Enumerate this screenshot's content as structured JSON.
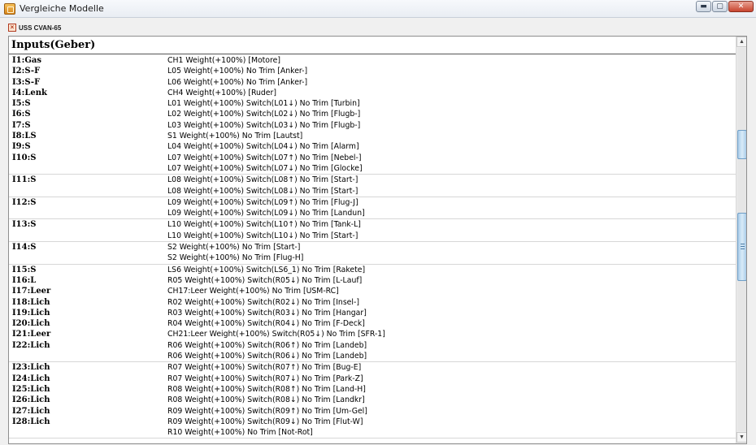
{
  "window": {
    "title": "Vergleiche Modelle",
    "buttons": {
      "minimize": "▬",
      "maximize": "▢",
      "close": "✕"
    }
  },
  "tab": {
    "icon": "document-icon",
    "label": "USS CVAN-65"
  },
  "section": {
    "title": "Inputs(Geber)"
  },
  "inputs": [
    {
      "label": "I1:Gas",
      "lines": [
        "CH1 Weight(+100%) [Motore]"
      ]
    },
    {
      "label": "I2:S-F",
      "lines": [
        "L05 Weight(+100%) No Trim [Anker-]"
      ]
    },
    {
      "label": "I3:S-F",
      "lines": [
        "L06 Weight(+100%) No Trim [Anker-]"
      ]
    },
    {
      "label": "I4:Lenk",
      "lines": [
        "CH4 Weight(+100%) [Ruder]"
      ]
    },
    {
      "label": "I5:S",
      "lines": [
        "L01 Weight(+100%) Switch(L01↓) No Trim [Turbin]"
      ]
    },
    {
      "label": "I6:S",
      "lines": [
        "L02 Weight(+100%) Switch(L02↓) No Trim [Flugb-]"
      ]
    },
    {
      "label": "I7:S",
      "lines": [
        "L03 Weight(+100%) Switch(L03↓) No Trim [Flugb-]"
      ]
    },
    {
      "label": "I8:LS",
      "lines": [
        "S1 Weight(+100%) No Trim [Lautst]"
      ]
    },
    {
      "label": "I9:S",
      "lines": [
        "L04 Weight(+100%) Switch(L04↓) No Trim [Alarm]"
      ]
    },
    {
      "label": "I10:S",
      "lines": [
        "L07 Weight(+100%) Switch(L07↑) No Trim [Nebel-]",
        "L07 Weight(+100%) Switch(L07↓) No Trim [Glocke]"
      ]
    },
    {
      "label": "I11:S",
      "lines": [
        "L08 Weight(+100%) Switch(L08↑) No Trim [Start-]",
        "L08 Weight(+100%) Switch(L08↓) No Trim [Start-]"
      ]
    },
    {
      "label": "I12:S",
      "lines": [
        "L09 Weight(+100%) Switch(L09↑) No Trim [Flug-J]",
        "L09 Weight(+100%) Switch(L09↓) No Trim [Landun]"
      ]
    },
    {
      "label": "I13:S",
      "lines": [
        "L10 Weight(+100%) Switch(L10↑) No Trim [Tank-L]",
        "L10 Weight(+100%) Switch(L10↓) No Trim [Start-]"
      ]
    },
    {
      "label": "I14:S",
      "lines": [
        "S2 Weight(+100%) No Trim [Start-]",
        "S2 Weight(+100%) No Trim [Flug-H]"
      ]
    },
    {
      "label": "I15:S",
      "lines": [
        "LS6 Weight(+100%) Switch(LS6_1) No Trim [Rakete]"
      ]
    },
    {
      "label": "I16:L",
      "lines": [
        "R05 Weight(+100%) Switch(R05↓) No Trim [L-Lauf]"
      ]
    },
    {
      "label": "I17:Leer",
      "lines": [
        "CH17:Leer Weight(+100%) No Trim [USM-RC]"
      ]
    },
    {
      "label": "I18:Lich",
      "lines": [
        "R02 Weight(+100%) Switch(R02↓) No Trim [Insel-]"
      ]
    },
    {
      "label": "I19:Lich",
      "lines": [
        "R03 Weight(+100%) Switch(R03↓) No Trim [Hangar]"
      ]
    },
    {
      "label": "I20:Lich",
      "lines": [
        "R04 Weight(+100%) Switch(R04↓) No Trim [F-Deck]"
      ]
    },
    {
      "label": "I21:Leer",
      "lines": [
        "CH21:Leer Weight(+100%) Switch(R05↓) No Trim [SFR-1]"
      ]
    },
    {
      "label": "I22:Lich",
      "lines": [
        "R06 Weight(+100%) Switch(R06↑) No Trim [Landeb]",
        "R06 Weight(+100%) Switch(R06↓) No Trim [Landeb]"
      ]
    },
    {
      "label": "I23:Lich",
      "lines": [
        "R07 Weight(+100%) Switch(R07↑) No Trim [Bug-E]"
      ]
    },
    {
      "label": "I24:Lich",
      "lines": [
        "R07 Weight(+100%) Switch(R07↓) No Trim [Park-Z]"
      ]
    },
    {
      "label": "I25:Lich",
      "lines": [
        "R08 Weight(+100%) Switch(R08↑) No Trim [Land-H]"
      ]
    },
    {
      "label": "I26:Lich",
      "lines": [
        "R08 Weight(+100%) Switch(R08↓) No Trim [Landkr]"
      ]
    },
    {
      "label": "I27:Lich",
      "lines": [
        "R09 Weight(+100%) Switch(R09↑) No Trim [Um-Gel]"
      ]
    },
    {
      "label": "I28:Lich",
      "lines": [
        "R09 Weight(+100%) Switch(R09↓) No Trim [Flut-W]",
        "R10 Weight(+100%) No Trim [Not-Rot]"
      ]
    }
  ],
  "scrollbar": {
    "up_glyph": "▲",
    "down_glyph": "▼"
  }
}
